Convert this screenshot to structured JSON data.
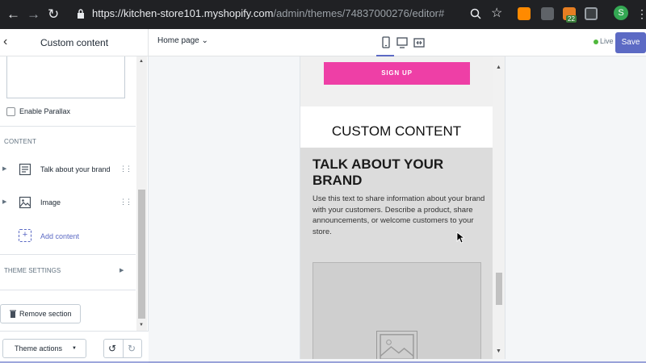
{
  "browser": {
    "url_host": "https://kitchen-store101.myshopify.com",
    "url_path": "/admin/themes/74837000276/editor#",
    "profile_initial": "S",
    "extension_badge": "22"
  },
  "editor": {
    "panel_title": "Custom content",
    "page_select": "Home page",
    "live_label": "Live",
    "save_label": "Save",
    "accent_color": "#5c6ac4"
  },
  "sidebar": {
    "enable_parallax_label": "Enable Parallax",
    "content_header": "CONTENT",
    "blocks": [
      {
        "label": "Talk about your brand",
        "icon": "text-block-icon"
      },
      {
        "label": "Image",
        "icon": "image-block-icon"
      }
    ],
    "add_content_label": "Add content",
    "theme_settings_header": "THEME SETTINGS",
    "remove_section_label": "Remove section",
    "theme_actions_label": "Theme actions"
  },
  "preview": {
    "signup_label": "SIGN UP",
    "section_title": "CUSTOM CONTENT",
    "brand_title": "TALK ABOUT YOUR BRAND",
    "brand_body": "Use this text to share information about your brand with your customers. Describe a product, share announcements, or welcome customers to your store.",
    "signup_color": "#ee3fa6"
  }
}
